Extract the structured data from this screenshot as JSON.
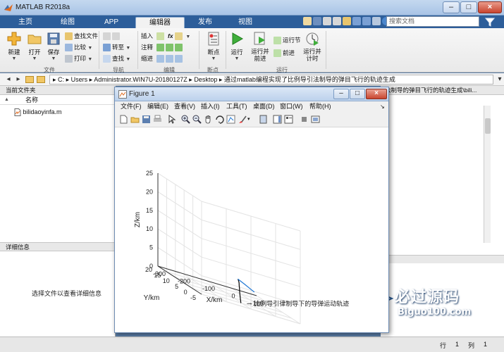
{
  "app": {
    "title": "MATLAB R2018a",
    "tabs": [
      "主页",
      "绘图",
      "APP",
      "编辑器",
      "发布",
      "视图"
    ],
    "active_tab": "编辑器",
    "search_placeholder": "搜索文档"
  },
  "ribbon": {
    "file": {
      "new": "新建",
      "open": "打开",
      "save": "保存",
      "find_files": "查找文件",
      "compare": "比较",
      "print": "打印",
      "group": "文件"
    },
    "nav": {
      "goto": "转至",
      "find": "查找",
      "group": "导航"
    },
    "edit": {
      "insert": "插入",
      "comment": "注释",
      "indent": "缩进",
      "fx": "fx",
      "group": "编辑"
    },
    "breakpoints": {
      "label": "断点",
      "group": "断点"
    },
    "run": {
      "run": "运行",
      "run_advance": "运行并\n前进",
      "run_section": "运行节",
      "advance": "前进",
      "run_time": "运行并\n计时",
      "group": "运行"
    }
  },
  "address": {
    "segments": [
      "C:",
      "Users",
      "Administrator.WIN7U-20180127Z",
      "Desktop",
      "通过matlab编程实现了比例导引法制导的弹目飞行的轨迹生成"
    ],
    "separator": "▸"
  },
  "current_folder": {
    "title": "当前文件夹",
    "col_name": "名称",
    "sort_indicator": "▲",
    "files": [
      "bilidaoyinfa.m"
    ]
  },
  "details": {
    "title": "详细信息",
    "message": "选择文件以查看详细信息"
  },
  "right_panel": {
    "header": "法制导的弹目飞行的轨迹生成\\bili..."
  },
  "statusbar": {
    "row_label": "行",
    "row": "1",
    "col_label": "列",
    "col": "1"
  },
  "figure": {
    "title": "Figure 1",
    "menus": [
      "文件(F)",
      "编辑(E)",
      "查看(V)",
      "插入(I)",
      "工具(T)",
      "桌面(D)",
      "窗口(W)",
      "帮助(H)"
    ],
    "zlabel": "Z/km",
    "ylabel": "Y/km",
    "xlabel": "X/km",
    "annotation": "比例导引律制导下的导弹运动轨迹",
    "annotation_arrow": "→"
  },
  "chart_data": {
    "type": "line",
    "title": "",
    "xlabel": "X/km",
    "ylabel": "Y/km",
    "zlabel": "Z/km",
    "xlim": [
      -300,
      100
    ],
    "ylim": [
      -5,
      20
    ],
    "zlim": [
      0,
      25
    ],
    "x_ticks": [
      -300,
      -200,
      -100,
      0,
      100
    ],
    "y_ticks": [
      -5,
      0,
      5,
      10,
      15,
      20
    ],
    "z_ticks": [
      0,
      5,
      10,
      15,
      20,
      25
    ],
    "grid": true,
    "series": [
      {
        "color": "#000000",
        "points": [
          [
            -105,
            0,
            0
          ],
          [
            -104,
            0.5,
            1.0
          ],
          [
            -102,
            1.0,
            2.0
          ],
          [
            -100,
            1.5,
            2.8
          ],
          [
            -97,
            2.0,
            3.6
          ],
          [
            -94,
            2.6,
            4.2
          ],
          [
            -90,
            3.2,
            4.7
          ],
          [
            -86,
            4.0,
            5.1
          ],
          [
            -82,
            5.0,
            5.4
          ]
        ]
      },
      {
        "color": "#1f77d4",
        "points": [
          [
            -82,
            5.0,
            5.4
          ],
          [
            -40,
            7.0,
            4.2
          ],
          [
            0,
            9.0,
            3.0
          ],
          [
            20,
            10.0,
            2.4
          ]
        ]
      }
    ]
  },
  "watermark": {
    "title": "必过源码",
    "subtitle": "Biguo100.com"
  }
}
